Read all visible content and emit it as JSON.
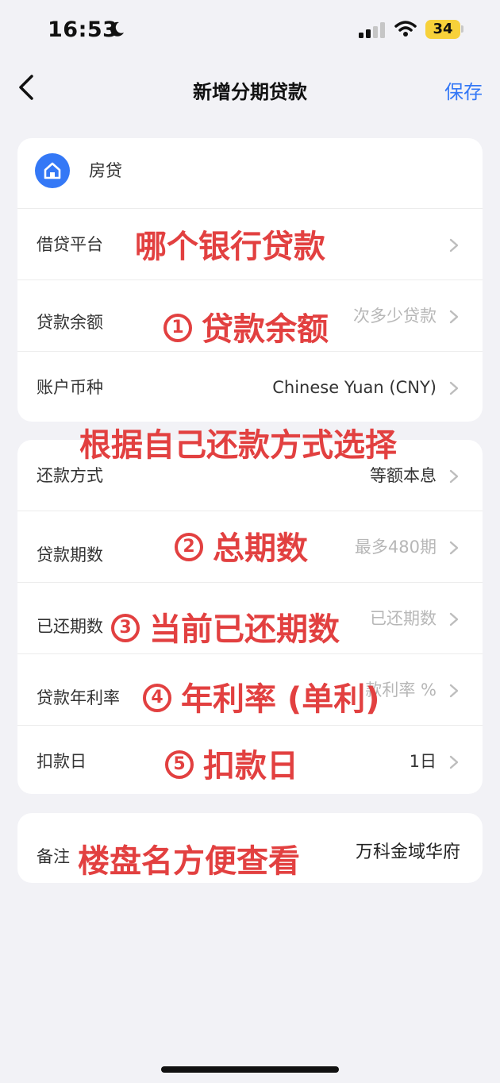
{
  "status_bar": {
    "time": "16:53",
    "battery": "34"
  },
  "nav": {
    "title": "新增分期贷款",
    "save_label": "保存"
  },
  "category": {
    "label": "房贷",
    "icon": "home-icon"
  },
  "card1_rows": [
    {
      "label": "借贷平台",
      "value": ""
    },
    {
      "label": "贷款余额",
      "value": "次多少贷款"
    },
    {
      "label": "账户币种",
      "value": "Chinese Yuan (CNY)"
    }
  ],
  "card2_rows": [
    {
      "label": "还款方式",
      "value": "等额本息"
    },
    {
      "label": "贷款期数",
      "value": "最多480期"
    },
    {
      "label": "已还期数",
      "value": "已还期数"
    },
    {
      "label": "贷款年利率",
      "value": "款利率 %"
    },
    {
      "label": "扣款日",
      "value": "1日"
    }
  ],
  "note": {
    "label": "备注",
    "value": "万科金域华府"
  },
  "annotations": {
    "platform": "哪个银行贷款",
    "balance_num": "1",
    "balance": "贷款余额",
    "method": "根据自己还款方式选择",
    "periods_num": "2",
    "periods": "总期数",
    "paid_num": "3",
    "paid": "当前已还期数",
    "rate_num": "4",
    "rate": "年利率 (单利)",
    "day_num": "5",
    "day": "扣款日",
    "note": "楼盘名方便查看"
  },
  "colors": {
    "accent": "#3478f6",
    "annotation": "#e24040",
    "battery": "#f7d13a"
  }
}
